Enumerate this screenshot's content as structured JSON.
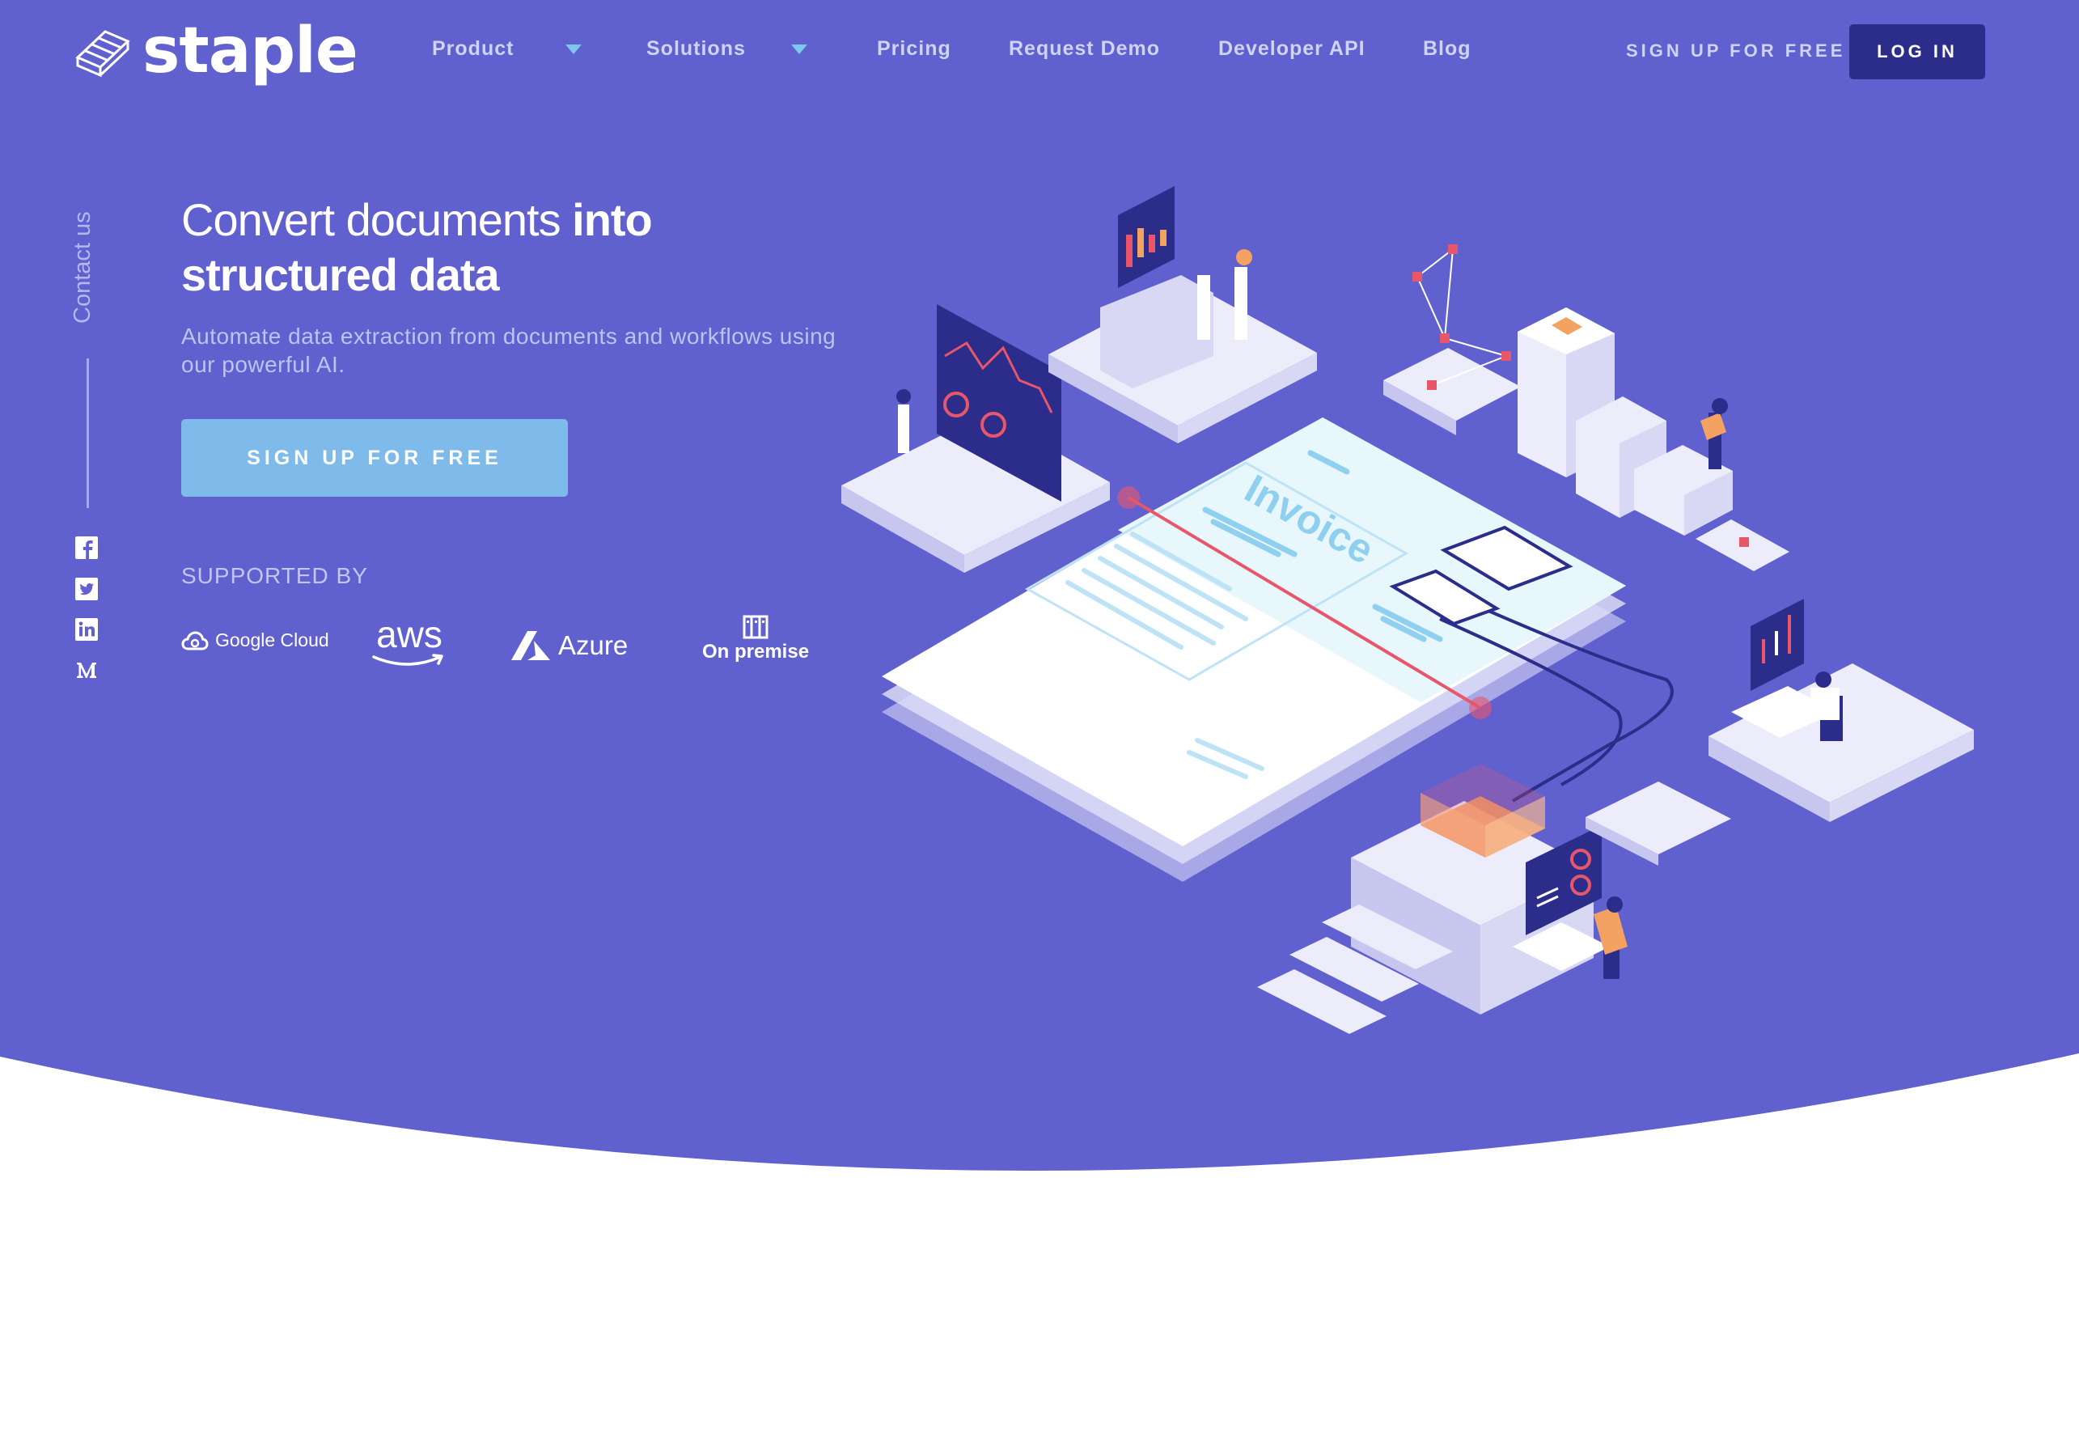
{
  "brand": {
    "name": "staple"
  },
  "nav": {
    "items": [
      {
        "label": "Product",
        "has_dropdown": true
      },
      {
        "label": "Solutions",
        "has_dropdown": true
      },
      {
        "label": "Pricing",
        "has_dropdown": false
      },
      {
        "label": "Request Demo",
        "has_dropdown": false
      },
      {
        "label": "Developer API",
        "has_dropdown": false
      },
      {
        "label": "Blog",
        "has_dropdown": false
      }
    ],
    "signup_label": "SIGN UP FOR FREE",
    "login_label": "LOG IN"
  },
  "sidebar": {
    "contact_label": "Contact us",
    "social": [
      {
        "name": "facebook-icon"
      },
      {
        "name": "twitter-icon"
      },
      {
        "name": "linkedin-icon"
      },
      {
        "name": "medium-icon"
      }
    ]
  },
  "hero": {
    "headline_light": "Convert documents ",
    "headline_bold_1": "into",
    "headline_bold_2": "structured data",
    "subhead": "Automate data extraction from documents and workflows using our powerful AI.",
    "cta_label": "SIGN UP FOR FREE",
    "supported_label": "SUPPORTED BY",
    "partners": {
      "google": "Google Cloud",
      "aws": "aws",
      "azure": "Azure",
      "onprem": "On premise"
    }
  },
  "illustration": {
    "invoice_label": "Invoice"
  },
  "colors": {
    "hero_bg": "#6060cf",
    "login_bg": "#2c2d8a",
    "cta_bg": "#7fbbea",
    "accent_red": "#e8566a"
  }
}
